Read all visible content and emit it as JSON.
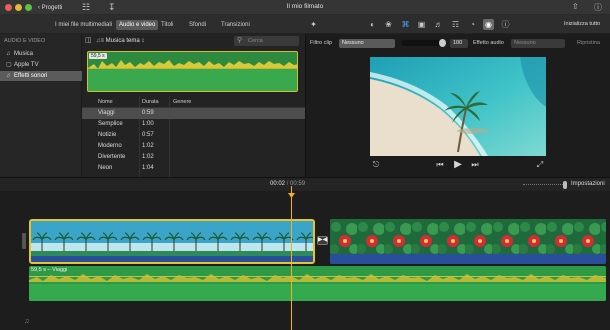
{
  "window": {
    "title": "Il mio filmato",
    "back_label": "Progetti",
    "reset_all": "Inizializza tutto"
  },
  "tabs": [
    {
      "label": "I miei file multimediali",
      "active": false
    },
    {
      "label": "Audio e video",
      "active": true
    },
    {
      "label": "Titoli",
      "active": false
    },
    {
      "label": "Sfondi",
      "active": false
    },
    {
      "label": "Transizioni",
      "active": false
    }
  ],
  "sidebar": {
    "section": "AUDIO E VIDEO",
    "items": [
      {
        "label": "Musica",
        "icon": "music-note-icon",
        "selected": false
      },
      {
        "label": "Apple TV",
        "icon": "tv-icon",
        "selected": false
      },
      {
        "label": "Effetti sonori",
        "icon": "speaker-icon",
        "selected": true
      }
    ]
  },
  "browser": {
    "source_select": "Musica tema ↕",
    "search_placeholder": "Cerca",
    "clip_thumb_label": "59,5 s"
  },
  "table": {
    "headers": [
      "Nome",
      "Durata",
      "Genere"
    ],
    "rows": [
      {
        "name": "Viaggi",
        "duration": "0:59",
        "genre": "",
        "selected": true
      },
      {
        "name": "Semplice",
        "duration": "1:00",
        "genre": "",
        "selected": false
      },
      {
        "name": "Notizie",
        "duration": "0:57",
        "genre": "",
        "selected": false
      },
      {
        "name": "Moderno",
        "duration": "1:02",
        "genre": "",
        "selected": false
      },
      {
        "name": "Divertente",
        "duration": "1:02",
        "genre": "",
        "selected": false
      },
      {
        "name": "Neon",
        "duration": "1:04",
        "genre": "",
        "selected": false
      }
    ]
  },
  "viewer": {
    "filter_clip_label": "Filtro clip",
    "filter_clip_value": "Nessuno",
    "volume_value": "100",
    "audio_effect_label": "Effetto audio",
    "audio_effect_value": "Nessuno",
    "reset_label": "Ripristina"
  },
  "timeline": {
    "current_time": "00:02",
    "separator": "/",
    "total_time": "00:59",
    "settings_label": "Impostazioni",
    "audio_clip_label": "59,5 s – Viaggi"
  },
  "colors": {
    "accent_selection": "#e5c52d",
    "audio_clip": "#2f9a46",
    "playhead": "#f2b022",
    "active_tool": "#6a6a6a"
  }
}
